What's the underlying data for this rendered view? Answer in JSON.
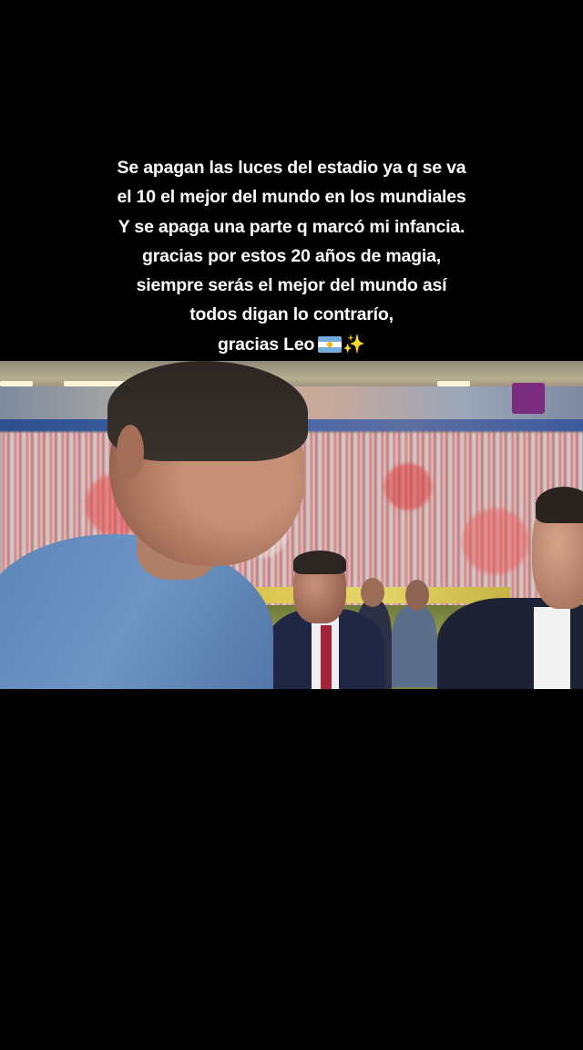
{
  "caption": {
    "lines": [
      "Se apagan las luces del estadio ya q se va",
      "el 10 el mejor del mundo en los mundiales",
      "Y se apaga una parte q marcó mi infancia.",
      "gracias por estos 20 años de magia,",
      "siempre serás el mejor del mundo así",
      "todos digan lo contrarío,",
      "gracias Leo"
    ],
    "emoji": [
      "argentina-flag",
      "sparkles"
    ]
  },
  "video": {
    "description_icons": [
      "broadcast-watermark-logo"
    ]
  },
  "colors": {
    "background": "#000000",
    "caption_text": "#ffffff"
  }
}
